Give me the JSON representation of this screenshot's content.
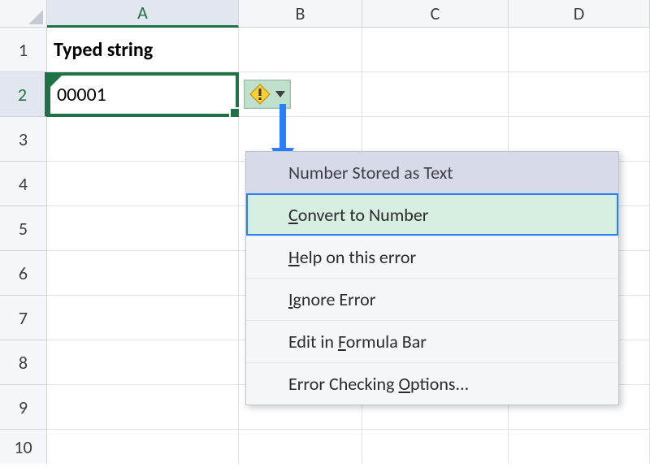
{
  "columns": {
    "A": "A",
    "B": "B",
    "C": "C",
    "D": "D"
  },
  "rows": [
    "1",
    "2",
    "3",
    "4",
    "5",
    "6",
    "7",
    "8",
    "9",
    "10"
  ],
  "cells": {
    "A1": "Typed string",
    "A2": "00001"
  },
  "error_popup": {
    "header": "Number Stored as Text",
    "convert": {
      "pre": "",
      "u": "C",
      "post": "onvert to Number"
    },
    "help": {
      "pre": "",
      "u": "H",
      "post": "elp on this error"
    },
    "ignore": {
      "pre": "",
      "u": "I",
      "post": "gnore Error"
    },
    "edit": {
      "pre": "Edit in ",
      "u": "F",
      "post": "ormula Bar"
    },
    "options": {
      "pre": "Error Checking ",
      "u": "O",
      "post": "ptions..."
    }
  }
}
